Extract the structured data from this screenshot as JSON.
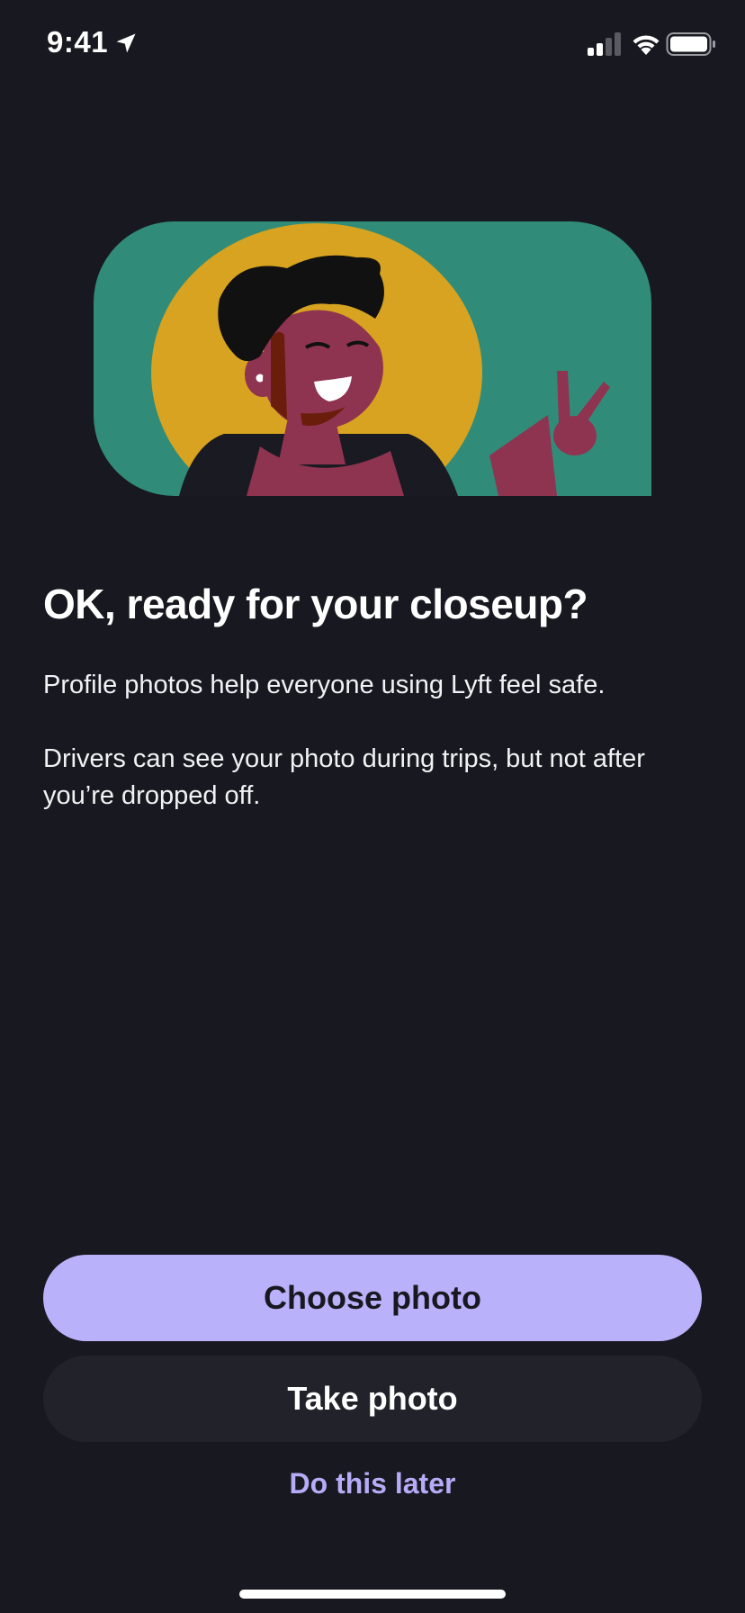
{
  "status_bar": {
    "time": "9:41",
    "icons": [
      "location-arrow-icon",
      "cellular-signal-icon",
      "wifi-icon",
      "battery-icon"
    ]
  },
  "illustration": {
    "subject": "smiling person making a peace sign",
    "colors": {
      "background": "#308c78",
      "circle": "#d7a320",
      "skin": "#8f3450",
      "hair": "#111111",
      "shirt": "#1a1a22"
    }
  },
  "content": {
    "title": "OK, ready for your closeup?",
    "paragraph_1": "Profile photos help everyone using Lyft feel safe.",
    "paragraph_2": "Drivers can see your photo during trips, but not after you’re dropped off."
  },
  "actions": {
    "choose_photo": "Choose photo",
    "take_photo": "Take photo",
    "do_this_later": "Do this later"
  },
  "theme": {
    "background": "#181820",
    "primary_button": "#b9b2fb",
    "secondary_button": "#22222b",
    "link": "#b7abf7"
  }
}
